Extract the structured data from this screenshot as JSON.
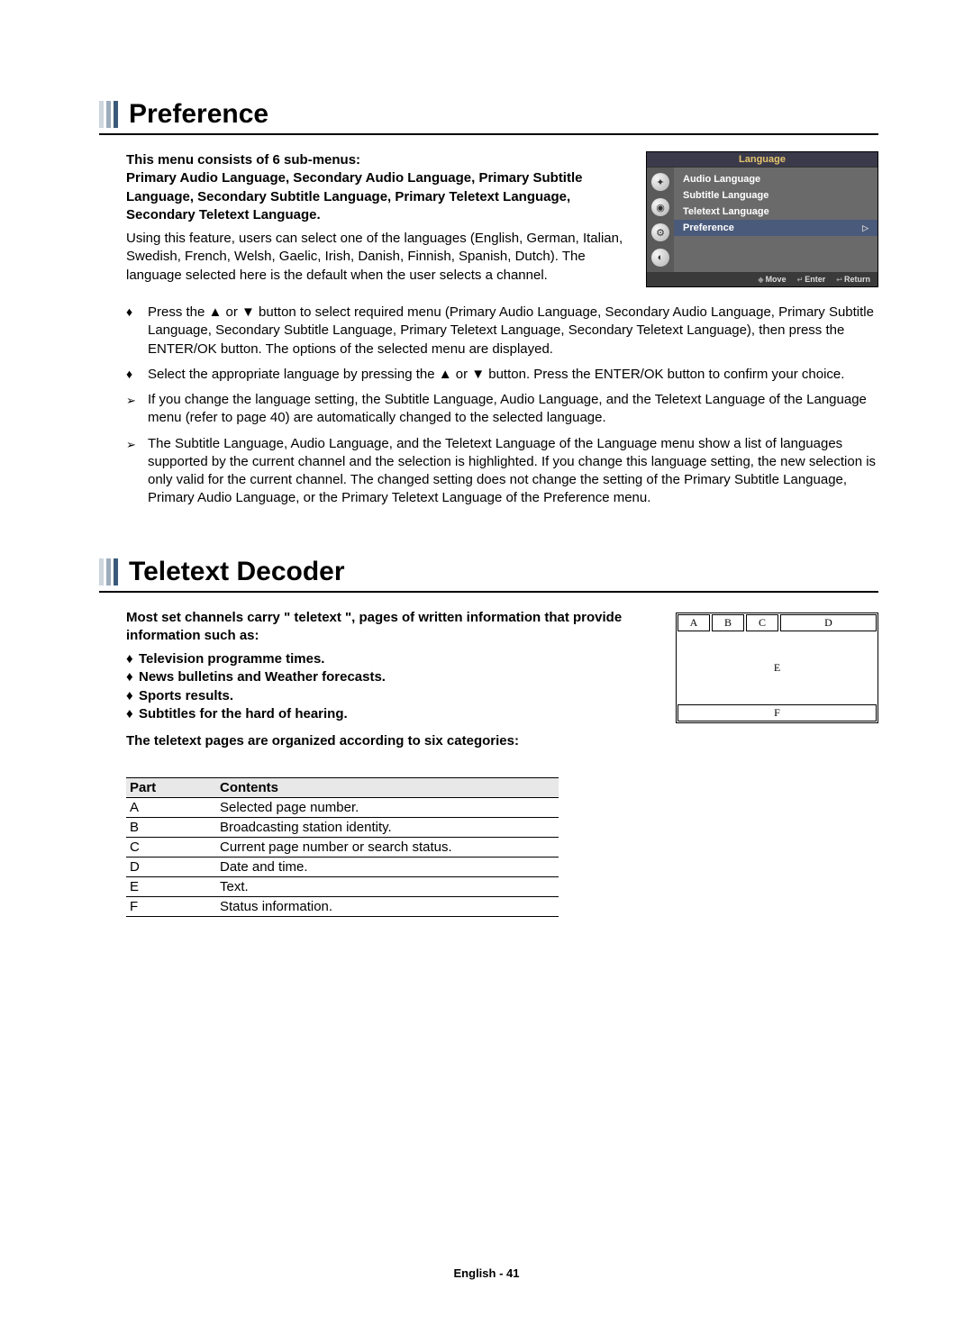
{
  "section1": {
    "title": "Preference",
    "intro_bold": "This menu consists of 6 sub-menus:\nPrimary Audio Language, Secondary Audio Language, Primary Subtitle Language, Secondary Subtitle Language, Primary Teletext Language, Secondary Teletext Language.",
    "intro_plain": "Using this feature, users can select one of the languages (English, German, Italian, Swedish, French, Welsh, Gaelic, Irish, Danish, Finnish, Spanish, Dutch). The language selected here is the default when the user selects a channel.",
    "bullets": [
      "Press the ▲ or ▼ button to select required menu (Primary Audio Language, Secondary Audio Language, Primary Subtitle Language, Secondary Subtitle Language, Primary Teletext Language, Secondary Teletext Language), then press the ENTER/OK button. The options of the selected menu are displayed.",
      "Select the appropriate language by pressing the ▲ or ▼ button. Press the ENTER/OK button to confirm your choice."
    ],
    "notes": [
      "If you change the language setting, the Subtitle Language, Audio Language, and the Teletext Language of the Language menu (refer to page 40) are automatically changed to the selected language.",
      "The Subtitle Language, Audio Language, and the Teletext Language of the Language menu show a list of languages supported by the current channel and the selection is highlighted. If you change this language setting, the new selection is only valid for the current channel. The changed setting does not change the setting of the Primary Subtitle Language, Primary Audio Language, or the Primary Teletext Language of the Preference menu."
    ]
  },
  "osd": {
    "title": "Language",
    "items": [
      "Audio Language",
      "Subtitle Language",
      "Teletext Language",
      "Preference"
    ],
    "selected_index": 3,
    "footer": {
      "move": "Move",
      "enter": "Enter",
      "return": "Return"
    }
  },
  "section2": {
    "title": "Teletext Decoder",
    "intro_bold": "Most set channels carry \" teletext \", pages of written information that provide information such as:",
    "intro_items": [
      "Television programme times.",
      "News bulletins and Weather forecasts.",
      "Sports results.",
      "Subtitles for the hard of hearing."
    ],
    "intro_tail": "The teletext pages are organized according to six categories:",
    "diagram": {
      "a": "A",
      "b": "B",
      "c": "C",
      "d": "D",
      "e": "E",
      "f": "F"
    },
    "table": {
      "headers": [
        "Part",
        "Contents"
      ],
      "rows": [
        [
          "A",
          "Selected page number."
        ],
        [
          "B",
          "Broadcasting station identity."
        ],
        [
          "C",
          "Current page number or search status."
        ],
        [
          "D",
          "Date and time."
        ],
        [
          "E",
          "Text."
        ],
        [
          "F",
          "Status information."
        ]
      ]
    }
  },
  "footer": "English - 41"
}
